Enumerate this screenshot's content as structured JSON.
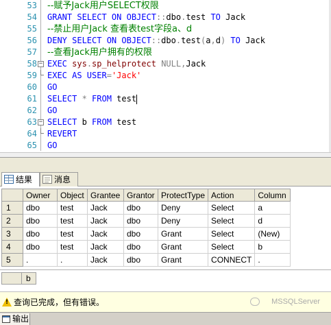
{
  "editor": {
    "lines": [
      {
        "n": "53",
        "parts": [
          {
            "t": "--赋予Jack用户SELECT权限",
            "c": "c"
          }
        ]
      },
      {
        "n": "54",
        "parts": [
          {
            "t": "GRANT SELECT ON OBJECT",
            "c": "k"
          },
          {
            "t": "::",
            "c": "g"
          },
          {
            "t": "dbo",
            "c": ""
          },
          {
            "t": ".",
            "c": "g"
          },
          {
            "t": "test ",
            "c": ""
          },
          {
            "t": "TO ",
            "c": "k"
          },
          {
            "t": "Jack",
            "c": ""
          }
        ]
      },
      {
        "n": "55",
        "parts": [
          {
            "t": "--禁止用户Jack 查看表test字段a、d",
            "c": "c"
          }
        ]
      },
      {
        "n": "56",
        "parts": [
          {
            "t": "DENY SELECT ON OBJECT",
            "c": "k"
          },
          {
            "t": "::",
            "c": "g"
          },
          {
            "t": "dbo",
            "c": ""
          },
          {
            "t": ".",
            "c": "g"
          },
          {
            "t": "test",
            "c": ""
          },
          {
            "t": "(",
            "c": "g"
          },
          {
            "t": "a",
            "c": ""
          },
          {
            "t": ",",
            "c": "g"
          },
          {
            "t": "d",
            "c": ""
          },
          {
            "t": ") ",
            "c": "g"
          },
          {
            "t": "TO ",
            "c": "k"
          },
          {
            "t": "Jack",
            "c": ""
          }
        ]
      },
      {
        "n": "57",
        "parts": [
          {
            "t": "--查看Jack用户拥有的权限",
            "c": "c"
          }
        ]
      },
      {
        "n": "58",
        "parts": [
          {
            "t": "EXEC ",
            "c": "k"
          },
          {
            "t": "sys",
            "c": "m"
          },
          {
            "t": ".",
            "c": "g"
          },
          {
            "t": "sp_helprotect ",
            "c": "m"
          },
          {
            "t": "NULL",
            "c": "g"
          },
          {
            "t": ",",
            "c": "g"
          },
          {
            "t": "Jack",
            "c": ""
          }
        ]
      },
      {
        "n": "59",
        "parts": [
          {
            "t": "EXEC AS USER",
            "c": "k"
          },
          {
            "t": "=",
            "c": "g"
          },
          {
            "t": "'Jack'",
            "c": "s"
          }
        ]
      },
      {
        "n": "60",
        "parts": [
          {
            "t": "GO",
            "c": "k"
          }
        ]
      },
      {
        "n": "61",
        "parts": [
          {
            "t": "SELECT ",
            "c": "k"
          },
          {
            "t": "* ",
            "c": "g"
          },
          {
            "t": "FROM ",
            "c": "k"
          },
          {
            "t": "test",
            "c": ""
          }
        ]
      },
      {
        "n": "62",
        "parts": [
          {
            "t": "GO",
            "c": "k"
          }
        ]
      },
      {
        "n": "63",
        "parts": [
          {
            "t": "SELECT ",
            "c": "k"
          },
          {
            "t": "b ",
            "c": ""
          },
          {
            "t": "FROM ",
            "c": "k"
          },
          {
            "t": "test",
            "c": ""
          }
        ]
      },
      {
        "n": "64",
        "parts": [
          {
            "t": "REVERT",
            "c": "k"
          }
        ]
      },
      {
        "n": "65",
        "parts": [
          {
            "t": "GO",
            "c": "k"
          }
        ]
      }
    ]
  },
  "tabs": {
    "results_label": "结果",
    "messages_label": "消息"
  },
  "grid1": {
    "columns": [
      "Owner",
      "Object",
      "Grantee",
      "Grantor",
      "ProtectType",
      "Action",
      "Column"
    ],
    "rows": [
      {
        "n": "1",
        "cells": [
          "dbo",
          "test",
          "Jack",
          "dbo",
          "Deny",
          "Select",
          "a"
        ]
      },
      {
        "n": "2",
        "cells": [
          "dbo",
          "test",
          "Jack",
          "dbo",
          "Deny",
          "Select",
          "d"
        ]
      },
      {
        "n": "3",
        "cells": [
          "dbo",
          "test",
          "Jack",
          "dbo",
          "Grant",
          "Select",
          "(New)"
        ]
      },
      {
        "n": "4",
        "cells": [
          "dbo",
          "test",
          "Jack",
          "dbo",
          "Grant",
          "Select",
          "b"
        ]
      },
      {
        "n": "5",
        "cells": [
          ".",
          ".",
          "Jack",
          "dbo",
          "Grant",
          "CONNECT",
          "."
        ]
      }
    ]
  },
  "grid2": {
    "column": "b"
  },
  "status": {
    "message": "查询已完成，但有错误。",
    "watermark": "MSSQLServer",
    "warning_color": "#f0c000"
  },
  "bottom": {
    "output_tab": "输出"
  }
}
